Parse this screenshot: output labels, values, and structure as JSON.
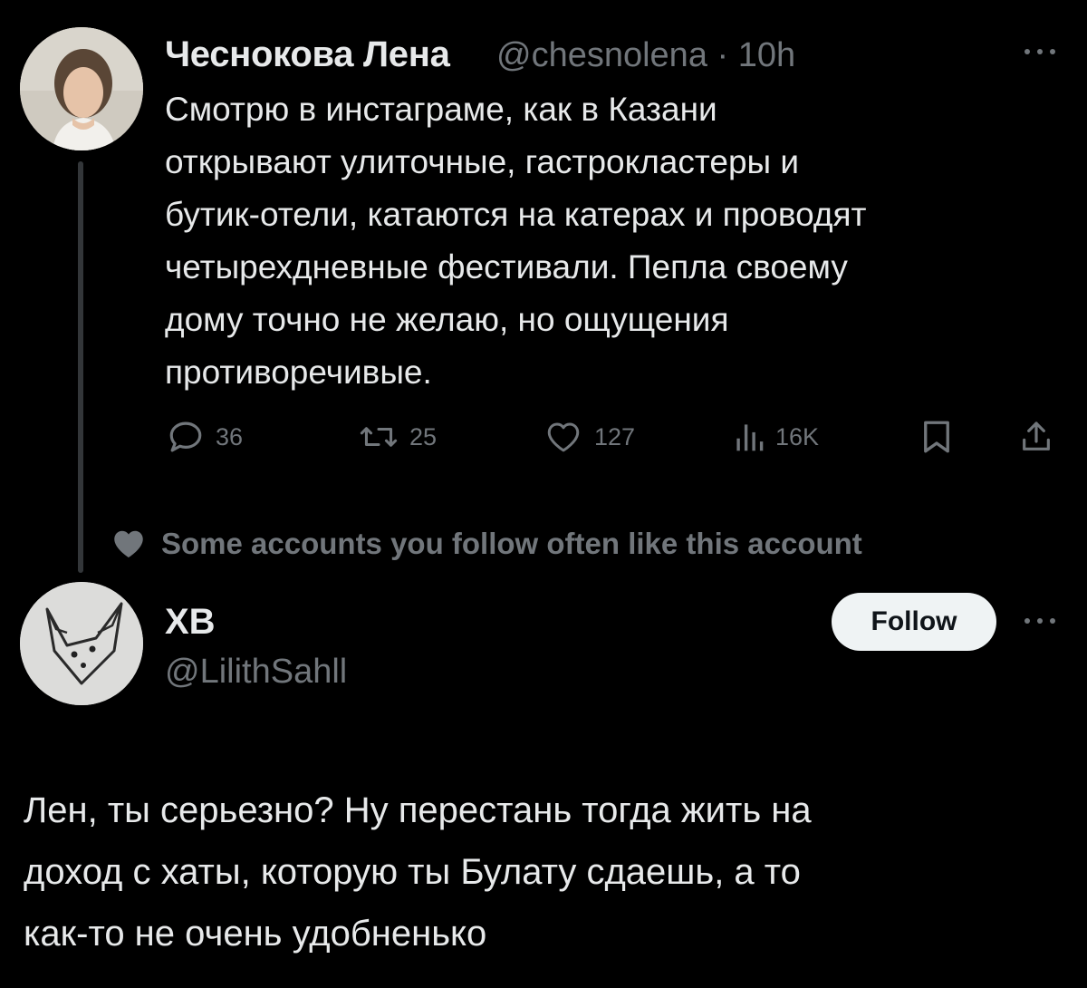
{
  "tweet": {
    "author_name": "Чеснокова Лена",
    "author_handle": "@chesnolena",
    "separator": "·",
    "time": "10h",
    "text": "Смотрю в инстаграме, как в Казани\nоткрывают улиточные, гастрокластеры и\nбутик-отели, катаются на катерах и проводят\nчетырехдневные фестивали. Пепла своему\nдому точно не желаю, но ощущения\nпротиворечивые.",
    "actions": {
      "replies": "36",
      "retweets": "25",
      "likes": "127",
      "views": "16K"
    }
  },
  "social_context": {
    "text": "Some accounts you follow often like this account"
  },
  "reply": {
    "author_name": "ХВ",
    "author_handle": "@LilithSahll",
    "follow_label": "Follow",
    "text": "Лен, ты серьезно? Ну перестань тогда жить на\nдоход с хаты, которую ты Булату сдаешь, а то\nкак-то не очень удобненько"
  },
  "colors": {
    "background": "#000000",
    "text_primary": "#e7e9ea",
    "text_secondary": "#71767b",
    "follow_button_bg": "#eff3f4",
    "thread_line": "#333639"
  },
  "icons": [
    "more-icon",
    "reply-icon",
    "retweet-icon",
    "like-icon",
    "views-icon",
    "bookmark-icon",
    "share-icon",
    "heart-icon"
  ]
}
